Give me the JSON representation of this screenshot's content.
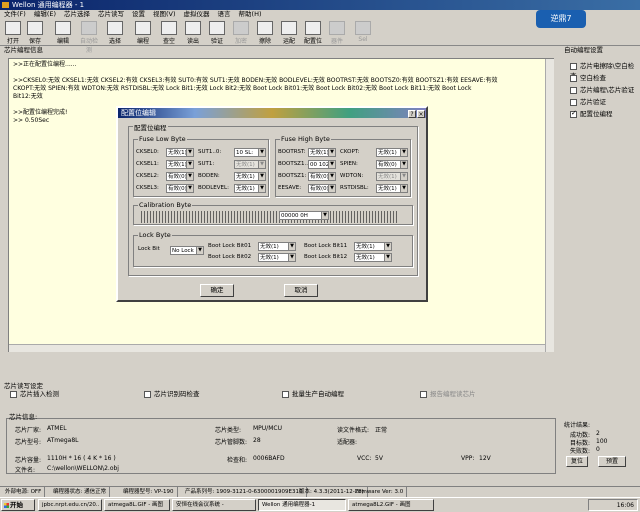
{
  "window": {
    "title": "Wellon 通用编程器 - 1"
  },
  "menu": [
    "文件(F)",
    "编辑(E)",
    "芯片选择",
    "芯片读写",
    "设置",
    "视图(V)",
    "虚拟仪器",
    "语言",
    "帮助(H)"
  ],
  "toolbar": [
    {
      "label": "打开",
      "icon": "folder-icon",
      "enabled": true
    },
    {
      "label": "保存",
      "icon": "save-icon",
      "enabled": true
    },
    {
      "label": "编辑",
      "icon": "edit-icon",
      "enabled": true
    },
    {
      "label": "自动检测",
      "icon": "auto-detect-icon",
      "enabled": false
    },
    {
      "label": "选择",
      "icon": "chip-select-icon",
      "enabled": true
    },
    {
      "label": "编程",
      "icon": "program-icon",
      "enabled": true
    },
    {
      "label": "查空",
      "icon": "blank-check-icon",
      "enabled": true
    },
    {
      "label": "读出",
      "icon": "read-icon",
      "enabled": true
    },
    {
      "label": "验证",
      "icon": "verify-icon",
      "enabled": true
    },
    {
      "label": "加密",
      "icon": "lock-icon",
      "enabled": false
    },
    {
      "label": "擦除",
      "icon": "erase-icon",
      "enabled": true
    },
    {
      "label": "运配",
      "icon": "config-run-icon",
      "enabled": true
    },
    {
      "label": "配置位",
      "icon": "config-bits-icon",
      "enabled": true
    },
    {
      "label": "器件",
      "icon": "device-icon",
      "enabled": false
    },
    {
      "label": "Sel",
      "icon": "sel-icon",
      "enabled": false
    }
  ],
  "logo": "逆鼎7",
  "main": {
    "group_title": "芯片编程信息",
    "log_lines": [
      ">>正在配置位编程......",
      "",
      ">>CKSEL0:无效     CKSEL1:无效     CKSEL2:有效     CKSEL3:有效     SUT0:有效     SUT1:无效     BODEN:无效     BODLEVEL:无效     BOOTRST:无效     BOOTSZ0:有效     BOOTSZ1:有效     EESAVE:有效",
      "CKOPT:无效     SPIEN:有效     WDTON:无效     RSTDISBL:无效     Lock Bit1:无效     Lock Bit2:无效     Boot Lock Bit01:无效     Boot Lock Bit02:无效     Boot Lock Bit11:无效     Boot Lock",
      "Bit12:无效",
      "",
      ">>配置位编程完成!",
      ">> 0.50Sec"
    ]
  },
  "right": {
    "group_title": "自动编程设置",
    "options": [
      {
        "label": "芯片电擦除\\空白检查",
        "checked": false
      },
      {
        "label": "空白检查",
        "checked": false
      },
      {
        "label": "芯片编程\\芯片验证",
        "checked": false
      },
      {
        "label": "芯片验证",
        "checked": false
      },
      {
        "label": "配置位编程",
        "checked": true
      }
    ]
  },
  "dialog": {
    "title": "配置位编辑",
    "group_title": "配置位编程",
    "fuse_low": {
      "title": "Fuse Low Byte",
      "rows": [
        {
          "label": "CKSEL0:",
          "value": "无效(1)",
          "label2": "SUT1..0:",
          "value2": "10 SL:"
        },
        {
          "label": "CKSEL1:",
          "value": "无效(1)",
          "label2": "SUT1:",
          "value2": "无效(1)"
        },
        {
          "label": "CKSEL2:",
          "value": "有效(0)",
          "label2": "BODEN:",
          "value2": "无效(1)"
        },
        {
          "label": "CKSEL3:",
          "value": "有效(0)",
          "label2": "BODLEVEL:",
          "value2": "无效(1)"
        }
      ]
    },
    "fuse_high": {
      "title": "Fuse High Byte",
      "rows": [
        {
          "label": "BOOTRST:",
          "value": "无效(1)",
          "label2": "CKOPT:",
          "value2": "无效(1)"
        },
        {
          "label": "BOOTSZ1..0:",
          "value": "00 1024",
          "label2": "SPIEN:",
          "value2": "有效(0)"
        },
        {
          "label": "BOOTSZ1:",
          "value": "有效(0)",
          "label2": "WDTON:",
          "value2": "无效(1)"
        },
        {
          "label": "EESAVE:",
          "value": "有效(0)",
          "label2": "RSTDISBL:",
          "value2": "无效(1)"
        }
      ]
    },
    "calibration": {
      "title": "Calibration Byte",
      "value": "00000 0H"
    },
    "lock": {
      "title": "Lock Byte",
      "lock_bit_label": "Lock Bit",
      "lock_bit_value": "No Lock",
      "items": [
        {
          "label": "Boot Lock Bit01",
          "value": "无效(1)"
        },
        {
          "label": "Boot Lock Bit11",
          "value": "无效(1)"
        },
        {
          "label": "Boot Lock Bit02",
          "value": "无效(1)"
        },
        {
          "label": "Boot Lock Bit12",
          "value": "无效(1)"
        }
      ]
    },
    "ok": "确定",
    "cancel": "取消"
  },
  "readwrite": {
    "group_title": "芯片读写设定",
    "options": [
      "芯片插入检测",
      "芯片识别码检查",
      "批量生产自动编程",
      "报告编程读芯片"
    ]
  },
  "info": {
    "group_title": "芯片信息:",
    "vendor_label": "芯片厂家:",
    "vendor": "ATMEL",
    "model_label": "芯片型号:",
    "model": "ATmega8L",
    "type_label": "芯片类型:",
    "type": "MPU/MCU",
    "pins_label": "芯片管脚数:",
    "pins": "28",
    "format_label": "读文件格式:",
    "format": "正常",
    "adapter_label": "适配器:",
    "adapter": "",
    "capacity_label": "芯片容量:",
    "capacity": "1110H * 16 ( 4 K * 16 )",
    "checksum_label": "检查和:",
    "checksum": "0006BAFD",
    "vcc_label": "VCC:",
    "vcc": "5V",
    "vpp_label": "VPP:",
    "vpp": "12V",
    "file_label": "文件名:",
    "file": "C:\\wellon\\WELLON\\2.obj"
  },
  "stats": {
    "title": "统计结果:",
    "success_label": "成功数:",
    "success": "2",
    "target_label": "目标数:",
    "target": "100",
    "fail_label": "失败数:",
    "fail": "0",
    "reset": "复位",
    "preset": "预置"
  },
  "statusbar": [
    "外部电源: OFF",
    "编程器状态: 通信正常",
    "编程器型号: VP-190",
    "产品系列号: 1909-3121-0-6300001909E316",
    "版本: 4.3.3(2011-12-28)",
    "Firmware Ver: 3.0"
  ],
  "taskbar": {
    "start": "开始",
    "tasks": [
      "jpbc.nrpt.edu.cn/20..",
      "atmega8L.GIF - 画图",
      "安恒在线会议系统 -",
      "Wellon 通用编程器-1",
      "atmega8L2.GIF - 画图"
    ],
    "active": 3,
    "clock": "16:06"
  }
}
